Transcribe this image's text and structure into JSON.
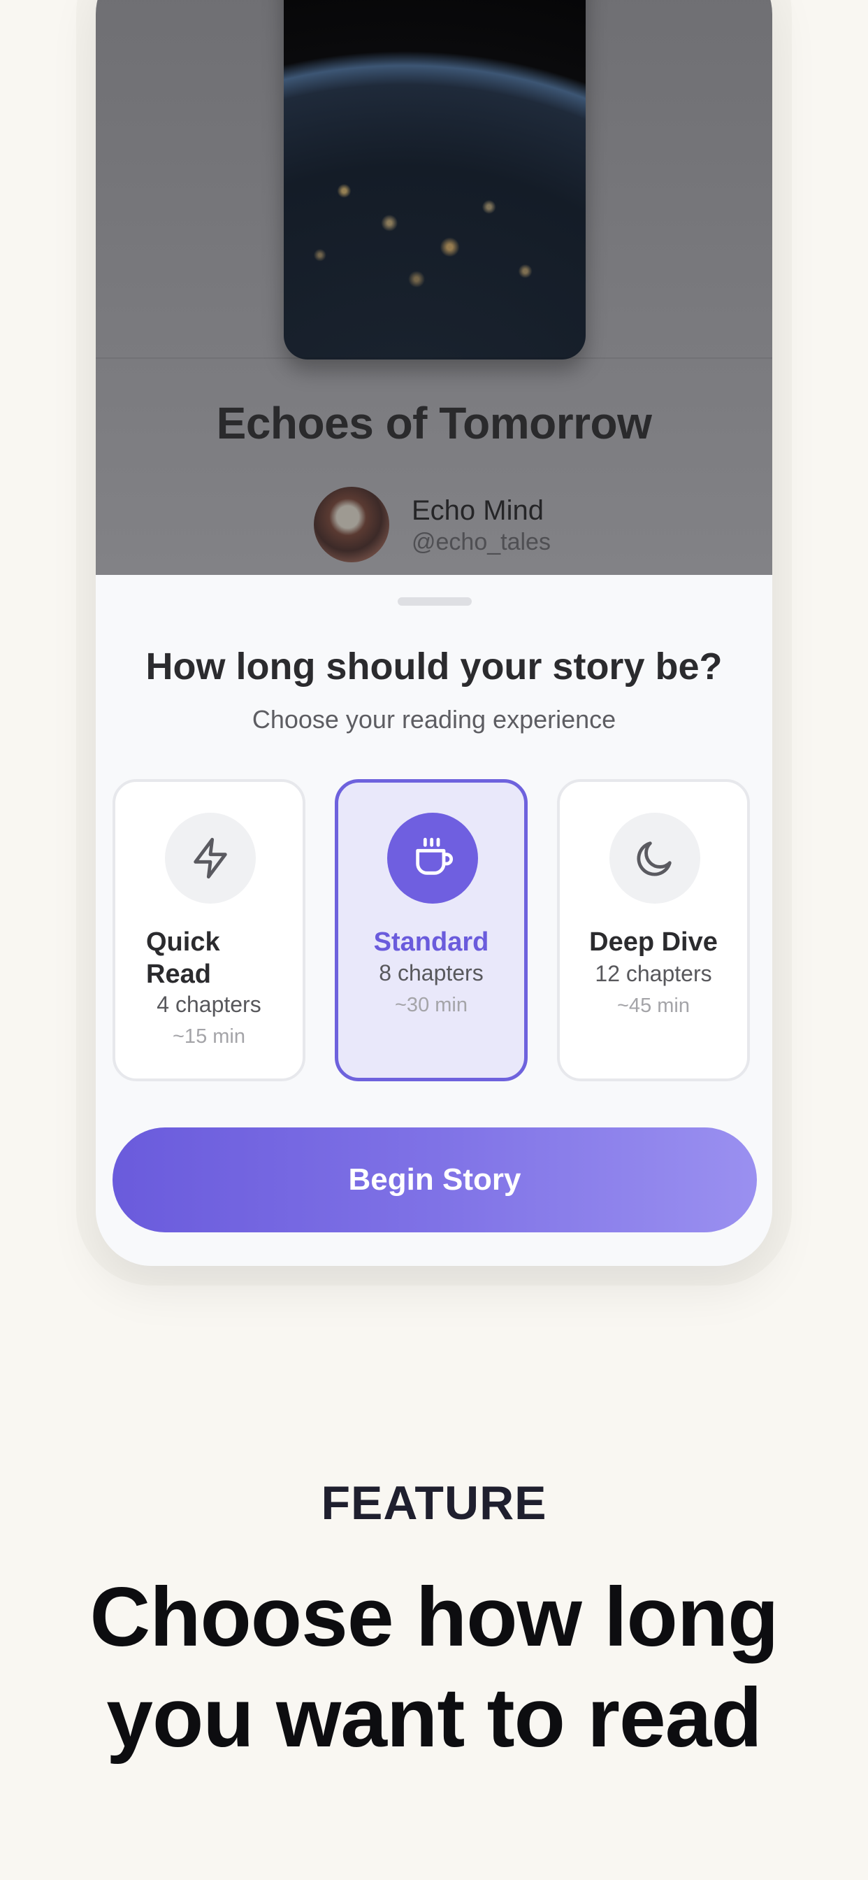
{
  "story": {
    "title": "Echoes of Tomorrow",
    "author_name": "Echo Mind",
    "author_handle": "@echo_tales"
  },
  "sheet": {
    "title": "How long should your story be?",
    "subtitle": "Choose your reading experience",
    "options": [
      {
        "label": "Quick Read",
        "chapters": "4 chapters",
        "time": "~15 min",
        "icon": "lightning-icon",
        "selected": false
      },
      {
        "label": "Standard",
        "chapters": "8 chapters",
        "time": "~30 min",
        "icon": "coffee-cup-icon",
        "selected": true
      },
      {
        "label": "Deep Dive",
        "chapters": "12 chapters",
        "time": "~45 min",
        "icon": "moon-icon",
        "selected": false
      }
    ],
    "cta_label": "Begin Story"
  },
  "marketing": {
    "eyebrow": "FEATURE",
    "headline_line1": "Choose how long",
    "headline_line2": "you want to read"
  },
  "colors": {
    "accent": "#6a5bdc",
    "accent_light": "#9a90f0",
    "page_background": "#f9f7f2",
    "selected_card_bg": "#e9e8fa"
  }
}
